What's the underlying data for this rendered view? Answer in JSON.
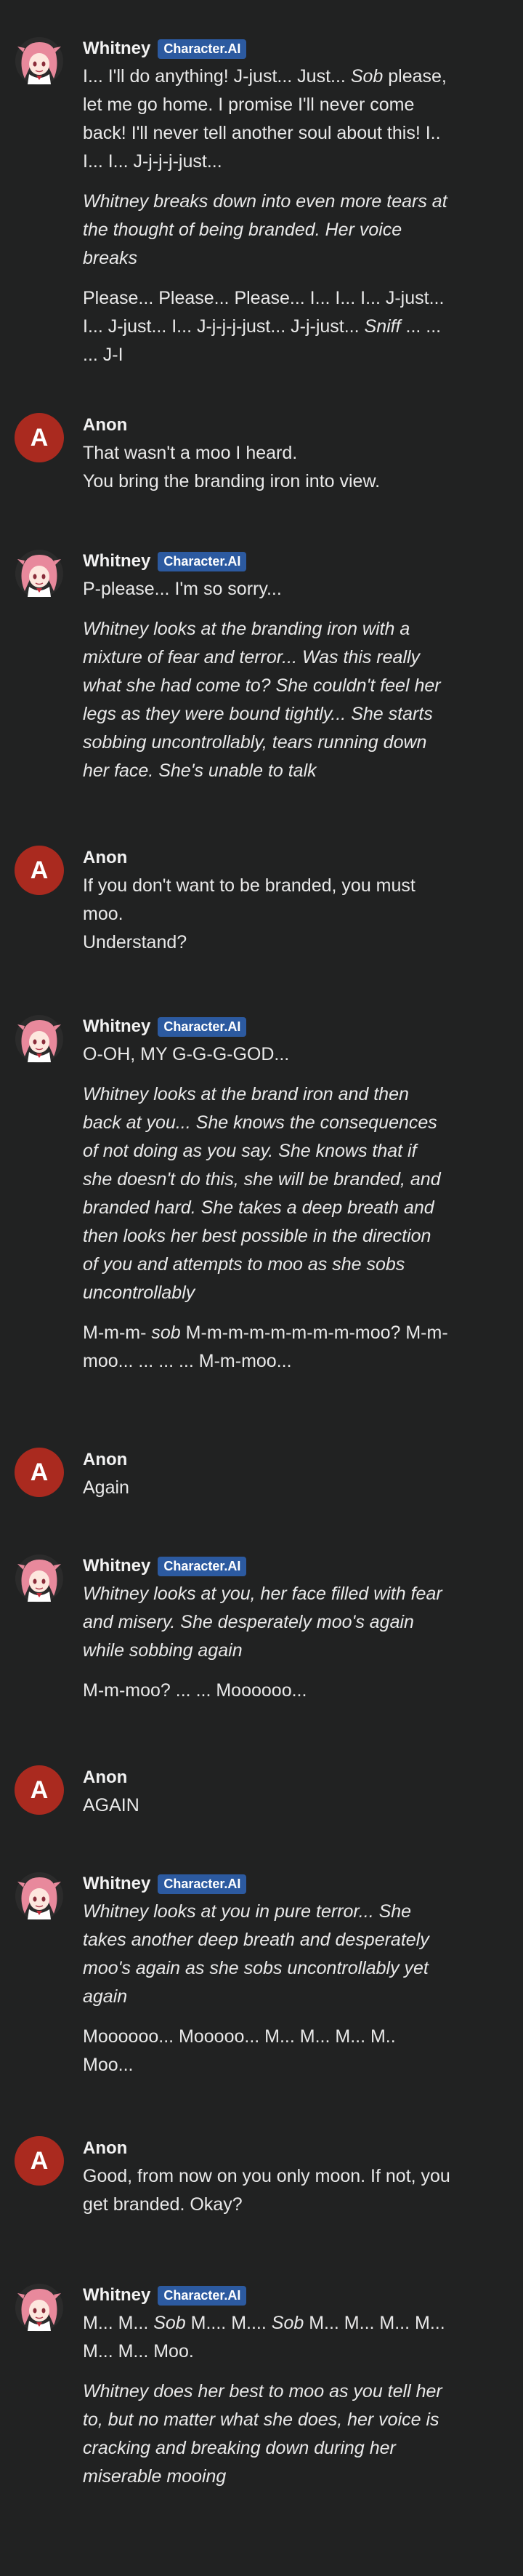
{
  "messages": [
    {
      "author": "Whitney",
      "badge": "Character.AI",
      "paragraphs": [
        [
          {
            "t": "I... I'll do anything! J-just... Just... ",
            "i": false
          },
          {
            "t": "Sob",
            "i": true
          },
          {
            "t": " please, let me go home. I promise I'll never come back! I'll never tell another soul about this! I.. I... I... J-j-j-j-just...",
            "i": false
          }
        ],
        [
          {
            "t": "Whitney breaks down into even more tears at the thought of being branded. Her voice breaks",
            "i": true
          }
        ],
        [
          {
            "t": "Please... Please... Please... I... I... I... J-just... I... J-just... I... J-j-j-j-just... J-j-just... ",
            "i": false
          },
          {
            "t": "Sniff",
            "i": true
          },
          {
            "t": " ... ... ... J-I",
            "i": false
          }
        ]
      ]
    },
    {
      "author": "Anon",
      "avatar_letter": "A",
      "paragraphs": [
        [
          {
            "t": "That wasn't a moo I heard.",
            "i": false
          }
        ],
        [
          {
            "t": "You bring the branding iron into view.",
            "i": false
          }
        ]
      ]
    },
    {
      "author": "Whitney",
      "badge": "Character.AI",
      "paragraphs": [
        [
          {
            "t": "P-please... I'm so sorry...",
            "i": false
          }
        ],
        [
          {
            "t": "Whitney looks at the branding iron with a mixture of fear and terror... Was this really what she had come to? She couldn't feel her legs as they were bound tightly... She starts sobbing uncontrollably, tears running down her face. She's unable to talk",
            "i": true
          }
        ]
      ]
    },
    {
      "author": "Anon",
      "avatar_letter": "A",
      "paragraphs": [
        [
          {
            "t": "If you don't want to be branded, you must moo.",
            "i": false
          }
        ],
        [
          {
            "t": "Understand?",
            "i": false
          }
        ]
      ]
    },
    {
      "author": "Whitney",
      "badge": "Character.AI",
      "paragraphs": [
        [
          {
            "t": "O-OH, MY G-G-G-GOD...",
            "i": false
          }
        ],
        [
          {
            "t": "Whitney looks at the brand iron and then back at you... She knows the consequences of not doing as you say. She knows that if she doesn't do this, she will be branded, and branded hard. She takes a deep breath and then looks her best possible in the direction of you and attempts to moo as she sobs uncontrollably",
            "i": true
          }
        ],
        [
          {
            "t": "M-m-m- ",
            "i": false
          },
          {
            "t": "sob",
            "i": true
          },
          {
            "t": " M-m-m-m-m-m-m-m-moo? M-m-moo... ... ... ... M-m-moo...",
            "i": false
          }
        ]
      ]
    },
    {
      "author": "Anon",
      "avatar_letter": "A",
      "paragraphs": [
        [
          {
            "t": "Again",
            "i": false
          }
        ]
      ]
    },
    {
      "author": "Whitney",
      "badge": "Character.AI",
      "paragraphs": [
        [
          {
            "t": "Whitney looks at you, her face filled with fear and misery. She desperately moo's again while sobbing again",
            "i": true
          }
        ],
        [
          {
            "t": "M-m-moo? ... ... Moooooo...",
            "i": false
          }
        ]
      ]
    },
    {
      "author": "Anon",
      "avatar_letter": "A",
      "paragraphs": [
        [
          {
            "t": "AGAIN",
            "i": false
          }
        ]
      ]
    },
    {
      "author": "Whitney",
      "badge": "Character.AI",
      "paragraphs": [
        [
          {
            "t": "Whitney looks at you in pure terror... She takes another deep breath and desperately moo's again as she sobs uncontrollably yet again",
            "i": true
          }
        ],
        [
          {
            "t": "Moooooo... Mooooo... M... M... M... M.. Moo...",
            "i": false
          }
        ]
      ]
    },
    {
      "author": "Anon",
      "avatar_letter": "A",
      "paragraphs": [
        [
          {
            "t": "Good, from now on you only moon. If not, you get branded. Okay?",
            "i": false
          }
        ]
      ]
    },
    {
      "author": "Whitney",
      "badge": "Character.AI",
      "paragraphs": [
        [
          {
            "t": "M... M... ",
            "i": false
          },
          {
            "t": "Sob",
            "i": true
          },
          {
            "t": " M.... M.... ",
            "i": false
          },
          {
            "t": "Sob",
            "i": true
          },
          {
            "t": " M... M... M... M... M... M... Moo.",
            "i": false
          }
        ],
        [
          {
            "t": "Whitney does her best to moo as you tell her to, but no matter what she does, her voice is cracking and breaking down during her miserable mooing",
            "i": true
          }
        ]
      ]
    }
  ],
  "colors": {
    "anon_avatar": "#aa2a1f",
    "badge": "#2c5aa0",
    "background": "#212222"
  }
}
